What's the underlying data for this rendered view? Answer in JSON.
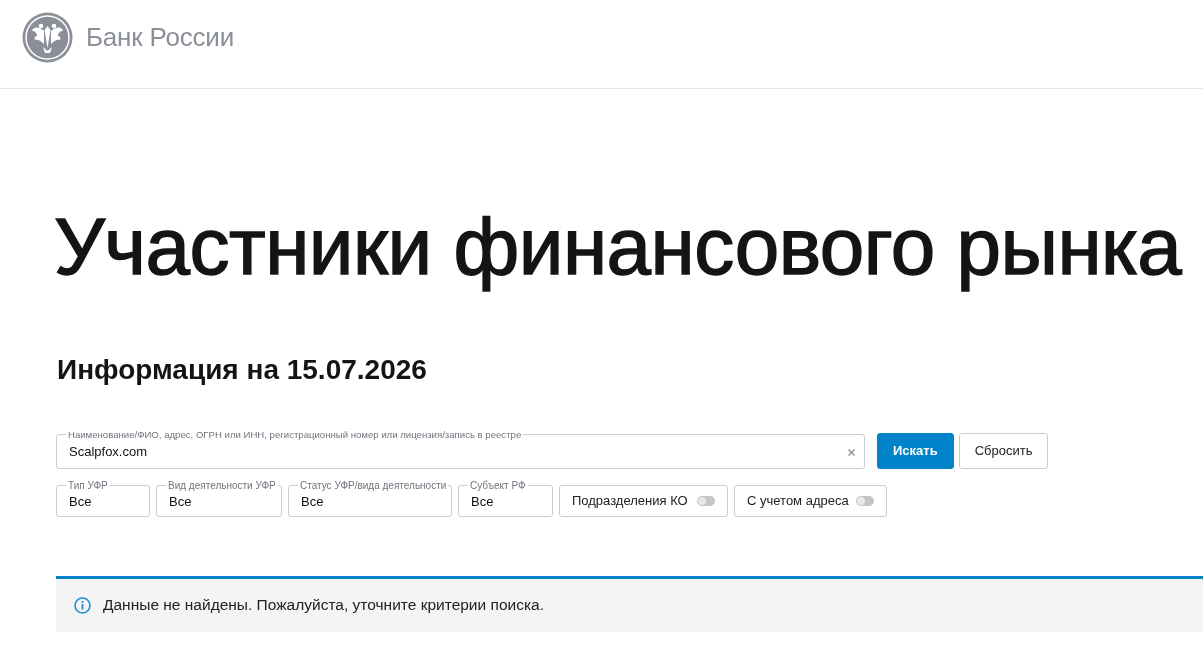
{
  "header": {
    "logo_text": "Банк России"
  },
  "title": "Участники финансового рынка",
  "subtitle": "Информация на 15.07.2026",
  "search": {
    "label": "Наименование/ФИО, адрес, ОГРН или ИНН, регистрационный номер или лицензия/запись в реестре",
    "value": "Scalpfox.com"
  },
  "buttons": [
    {
      "label": "Искать",
      "kind": "primary"
    },
    {
      "label": "Сбросить",
      "kind": "secondary"
    }
  ],
  "filters": [
    {
      "kind": "select",
      "label": "Тип УФР",
      "value": "Все"
    },
    {
      "kind": "select",
      "label": "Вид деятельности УФР",
      "value": "Все"
    },
    {
      "kind": "select",
      "label": "Статус УФР/вида деятельности",
      "value": "Все"
    },
    {
      "kind": "select",
      "label": "Субъект РФ",
      "value": "Все"
    },
    {
      "kind": "toggle",
      "label": "Подразделения КО",
      "on": false
    },
    {
      "kind": "toggle",
      "label": "С учетом адреса",
      "on": false
    }
  ],
  "notice": {
    "text": "Данные не найдены. Пожалуйста, уточните критерии поиска."
  }
}
